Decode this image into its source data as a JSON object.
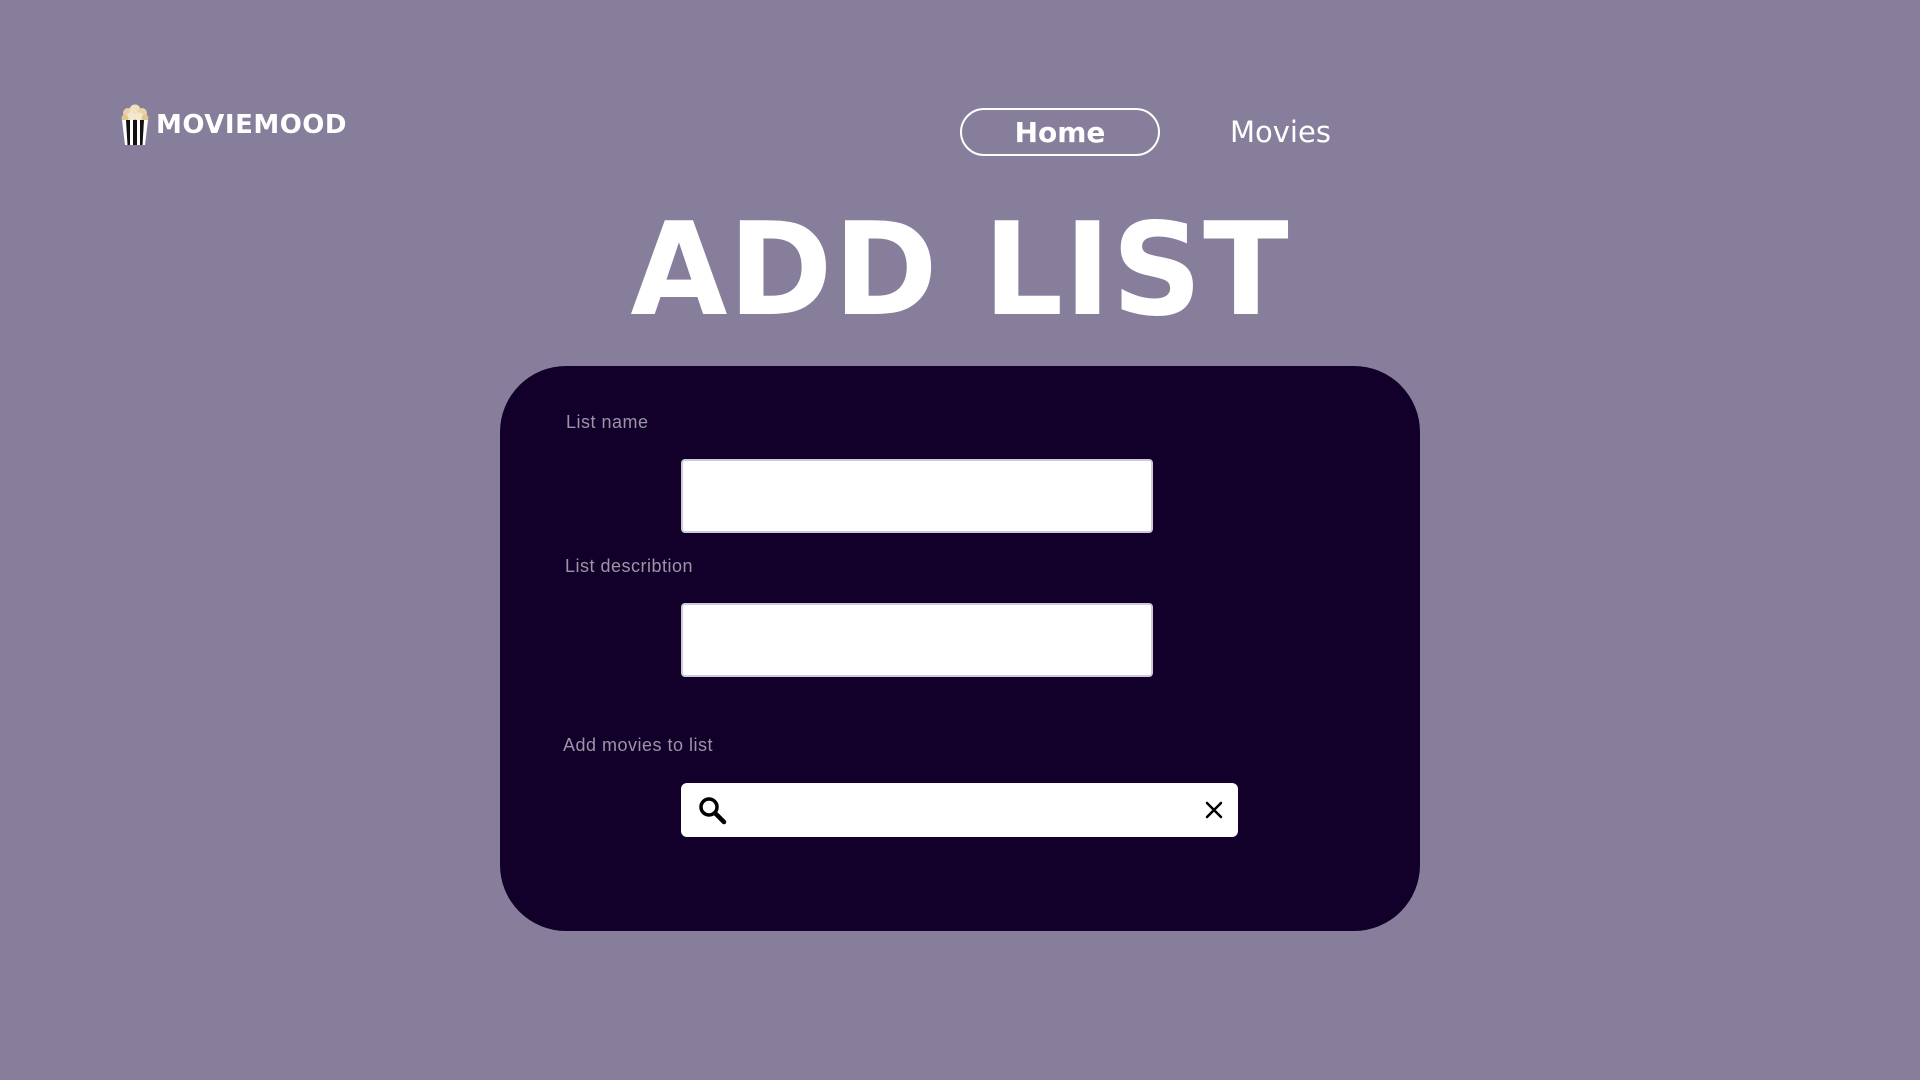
{
  "header": {
    "logo_text": "MOVIEMOOD",
    "logo_icon": "popcorn-icon",
    "nav": {
      "home_label": "Home",
      "movies_label": "Movies"
    }
  },
  "main": {
    "title": "ADD LIST",
    "form": {
      "list_name_label": "List name",
      "list_name_value": "",
      "list_description_label": "List describtion",
      "list_description_value": "",
      "add_movies_label": "Add movies to list",
      "search_value": "",
      "search_icon": "search-icon",
      "clear_icon": "close-icon"
    }
  },
  "colors": {
    "background": "#877e9c",
    "card": "#12002a",
    "text": "#ffffff",
    "label": "#9b95a8"
  }
}
